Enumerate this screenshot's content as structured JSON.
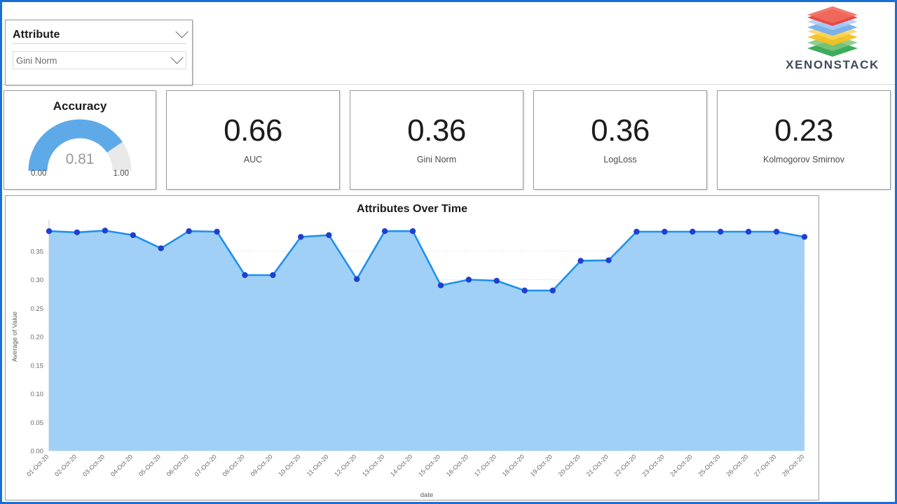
{
  "brand": {
    "name": "XENONSTACK",
    "logo_colors": [
      "#e8453c",
      "#76aef0",
      "#f4c020",
      "#34a853"
    ]
  },
  "filter": {
    "title": "Attribute",
    "selected_value": "Gini Norm",
    "chevron_icon": "chevron-down-icon"
  },
  "kpis": {
    "gauge": {
      "title": "Accuracy",
      "value": "0.81",
      "value_num": 0.81,
      "min_label": "0.00",
      "max_label": "1.00",
      "fill_color": "#5eaae8",
      "track_color": "#e9e9e9"
    },
    "cards": [
      {
        "value": "0.66",
        "label": "AUC"
      },
      {
        "value": "0.36",
        "label": "Gini Norm"
      },
      {
        "value": "0.36",
        "label": "LogLoss"
      },
      {
        "value": "0.23",
        "label": "Kolmogorov Smirnov"
      }
    ]
  },
  "chart_data": {
    "type": "area",
    "title": "Attributes Over Time",
    "xlabel": "date",
    "ylabel": "Average of Value",
    "ylim": [
      0.0,
      0.4
    ],
    "yticks": [
      "0.00",
      "0.05",
      "0.10",
      "0.15",
      "0.20",
      "0.25",
      "0.30",
      "0.35"
    ],
    "ytick_values": [
      0.0,
      0.05,
      0.1,
      0.15,
      0.2,
      0.25,
      0.3,
      0.35
    ],
    "grid": true,
    "legend": "none",
    "line_color": "#1e90f0",
    "marker_color": "#1f3fd0",
    "fill_color": "#9ccef5",
    "categories": [
      "01-Oct-20",
      "02-Oct-20",
      "03-Oct-20",
      "04-Oct-20",
      "05-Oct-20",
      "06-Oct-20",
      "07-Oct-20",
      "08-Oct-20",
      "09-Oct-20",
      "10-Oct-20",
      "11-Oct-20",
      "12-Oct-20",
      "13-Oct-20",
      "14-Oct-20",
      "15-Oct-20",
      "16-Oct-20",
      "17-Oct-20",
      "18-Oct-20",
      "19-Oct-20",
      "20-Oct-20",
      "21-Oct-20",
      "22-Oct-20",
      "23-Oct-20",
      "24-Oct-20",
      "25-Oct-20",
      "26-Oct-20",
      "27-Oct-20",
      "28-Oct-20"
    ],
    "values": [
      0.385,
      0.383,
      0.386,
      0.378,
      0.355,
      0.385,
      0.384,
      0.308,
      0.308,
      0.375,
      0.378,
      0.301,
      0.385,
      0.385,
      0.29,
      0.3,
      0.298,
      0.281,
      0.281,
      0.333,
      0.334,
      0.384,
      0.384,
      0.384,
      0.384,
      0.384,
      0.384,
      0.375
    ]
  }
}
